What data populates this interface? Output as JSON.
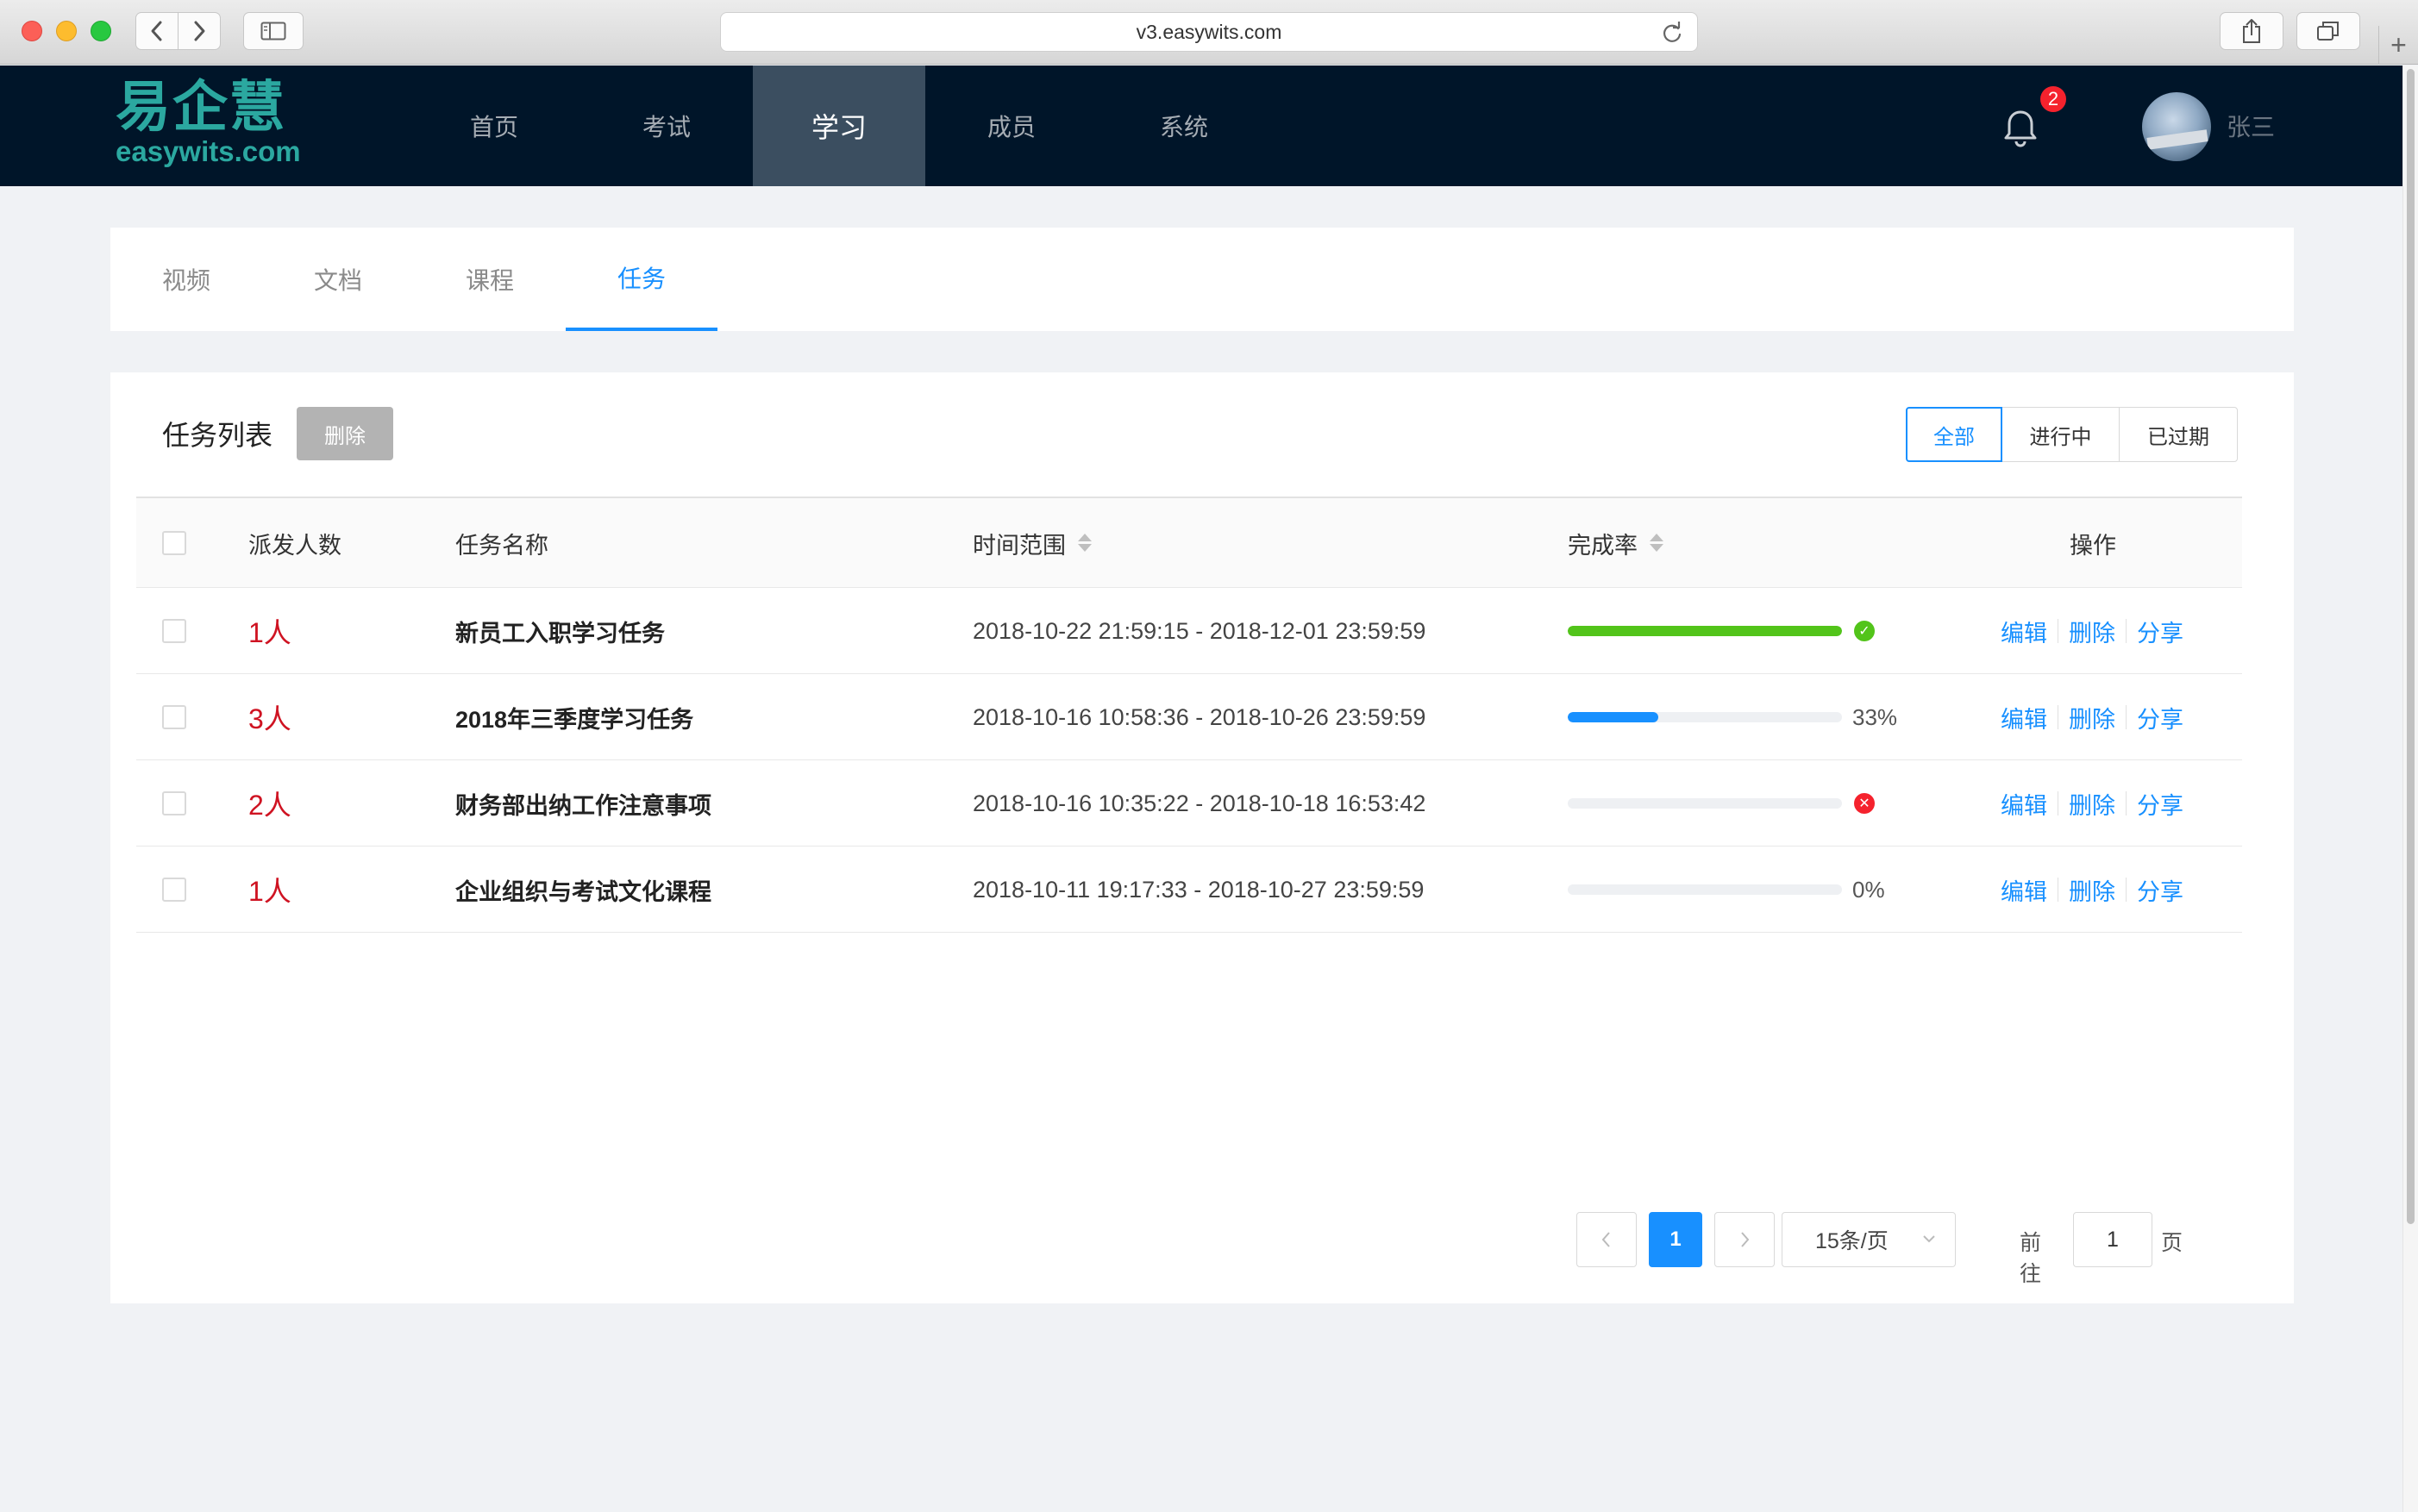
{
  "browser": {
    "url": "v3.easywits.com"
  },
  "header": {
    "logo_cn": "易企慧",
    "logo_en": "easywits.com",
    "nav": [
      {
        "label": "首页"
      },
      {
        "label": "考试"
      },
      {
        "label": "学习"
      },
      {
        "label": "成员"
      },
      {
        "label": "系统"
      }
    ],
    "active_nav": "学习",
    "notification_count": "2",
    "user_name": "张三"
  },
  "tabs": [
    {
      "label": "视频"
    },
    {
      "label": "文档"
    },
    {
      "label": "课程"
    },
    {
      "label": "任务"
    }
  ],
  "active_tab": "任务",
  "card": {
    "title": "任务列表",
    "delete_label": "删除",
    "filters": [
      {
        "label": "全部"
      },
      {
        "label": "进行中"
      },
      {
        "label": "已过期"
      }
    ],
    "active_filter": "全部"
  },
  "table": {
    "columns": {
      "count": "派发人数",
      "name": "任务名称",
      "time": "时间范围",
      "rate": "完成率",
      "ops": "操作"
    },
    "rows": [
      {
        "count": "1人",
        "name": "新员工入职学习任务",
        "time": "2018-10-22 21:59:15 - 2018-12-01 23:59:59",
        "progress": 1.0,
        "status": "success",
        "rate_text": "",
        "fill_color": "#52c41a"
      },
      {
        "count": "3人",
        "name": "2018年三季度学习任务",
        "time": "2018-10-16 10:58:36 - 2018-10-26 23:59:59",
        "progress": 0.33,
        "status": "normal",
        "rate_text": "33%",
        "fill_color": "#1890ff"
      },
      {
        "count": "2人",
        "name": "财务部出纳工作注意事项",
        "time": "2018-10-16 10:35:22 - 2018-10-18 16:53:42",
        "progress": 0.0,
        "status": "exception",
        "rate_text": "",
        "fill_color": "#1890ff"
      },
      {
        "count": "1人",
        "name": "企业组织与考试文化课程",
        "time": "2018-10-11 19:17:33 - 2018-10-27 23:59:59",
        "progress": 0.0,
        "status": "normal",
        "rate_text": "0%",
        "fill_color": "#1890ff"
      }
    ],
    "ops": {
      "edit": "编辑",
      "delete": "删除",
      "share": "分享"
    }
  },
  "pagination": {
    "current_page": "1",
    "page_size": "15条/页",
    "goto_label": "前往",
    "goto_value": "1",
    "page_suffix": "页"
  },
  "colors": {
    "accent": "#1890ff",
    "header_bg": "#001529",
    "success": "#52c41a",
    "error": "#f5222d",
    "count_red": "#cf1322"
  }
}
